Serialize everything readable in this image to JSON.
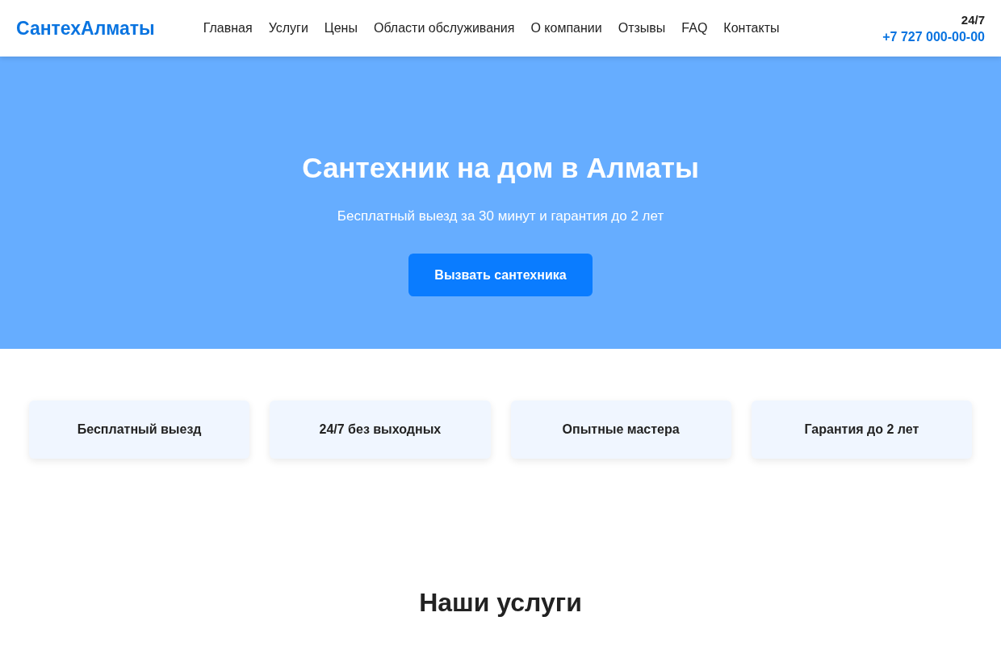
{
  "header": {
    "logo": "СантехАлматы",
    "nav": [
      {
        "label": "Главная"
      },
      {
        "label": "Услуги"
      },
      {
        "label": "Цены"
      },
      {
        "label": "Области обслуживания"
      },
      {
        "label": "О компании"
      },
      {
        "label": "Отзывы"
      },
      {
        "label": "FAQ"
      },
      {
        "label": "Контакты"
      }
    ],
    "hours": "24/7",
    "phone": "+7 727 000-00-00"
  },
  "hero": {
    "title": "Сантехник на дом в Алматы",
    "subtitle": "Бесплатный выезд за 30 минут и гарантия до 2 лет",
    "button": "Вызвать сантехника"
  },
  "features": [
    {
      "label": "Бесплатный выезд"
    },
    {
      "label": "24/7 без выходных"
    },
    {
      "label": "Опытные мастера"
    },
    {
      "label": "Гарантия до 2 лет"
    }
  ],
  "services": {
    "title": "Наши услуги"
  }
}
